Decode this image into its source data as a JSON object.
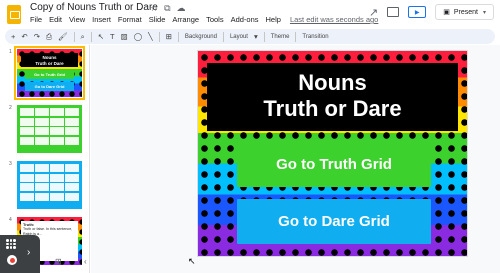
{
  "header": {
    "doc_title": "Copy of Nouns Truth or Dare",
    "menu": [
      "File",
      "Edit",
      "View",
      "Insert",
      "Format",
      "Slide",
      "Arrange",
      "Tools",
      "Add-ons",
      "Help"
    ],
    "last_edit": "Last edit was seconds ago",
    "present_label": "Present"
  },
  "toolbar": {
    "background_label": "Background",
    "layout_label": "Layout",
    "theme_label": "Theme",
    "transition_label": "Transition"
  },
  "filmstrip": {
    "slides": [
      {
        "num": "1",
        "title_line1": "Nouns",
        "title_line2": "Truth or Dare",
        "btn1": "Go to Truth Grid",
        "btn2": "Go to Dare Grid"
      },
      {
        "num": "2"
      },
      {
        "num": "3"
      },
      {
        "num": "4",
        "card_head": "Truth:",
        "card_text": "Truth or false. In this sentence, Ralph is a..."
      }
    ]
  },
  "slide": {
    "title_line1": "Nouns",
    "title_line2": "Truth or Dare",
    "truth_button": "Go to Truth Grid",
    "dare_button": "Go to Dare Grid"
  },
  "colors": {
    "accent_blue": "#1a73e8",
    "truth_green": "#3cd12c",
    "dare_blue": "#10aef0",
    "selected_outline": "#fbbc04"
  }
}
